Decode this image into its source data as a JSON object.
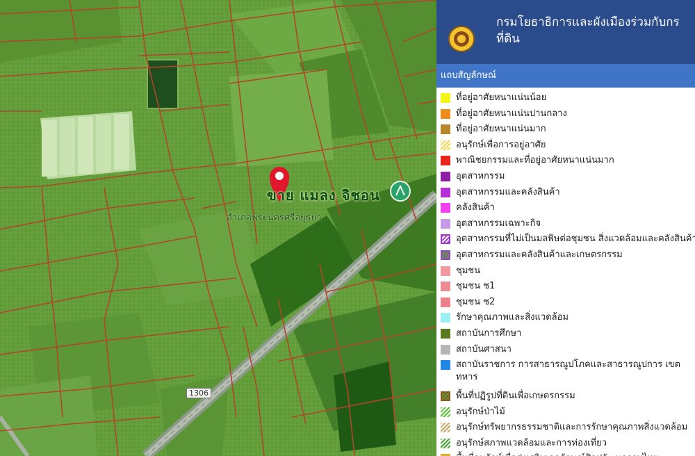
{
  "map": {
    "pin_label": "ขาย แมลง จิชอน",
    "sub_label": "อำเภอพระนครศรีอยุธยา",
    "road_number": "1306"
  },
  "panel": {
    "title": "กรมโยธาธิการและผังเมืองร่วมกับกรมที่ดิน",
    "title_lines": "กรมโยธาธิการและผังเมืองร่วมกับกร\nที่ดิน",
    "legend_tab": "แถบสัญลักษณ์",
    "legend": [
      {
        "label": "ที่อยู่อาศัยหนาแน่นน้อย",
        "color": "#f5f51a",
        "pattern": "solid"
      },
      {
        "label": "ที่อยู่อาศัยหนาแน่นปานกลาง",
        "color": "#f08c1e",
        "pattern": "solid"
      },
      {
        "label": "ที่อยู่อาศัยหนาแน่นมาก",
        "color": "#b8862a",
        "pattern": "solid"
      },
      {
        "label": "อนุรักษ์เพื่อการอยู่อาศัย",
        "color": "#f2d44a",
        "pattern": "hatch"
      },
      {
        "label": "พาณิชยกรรมและที่อยู่อาศัยหนาแน่นมาก",
        "color": "#e8251c",
        "pattern": "solid"
      },
      {
        "label": "อุตสาหกรรม",
        "color": "#8e1fa6",
        "pattern": "solid"
      },
      {
        "label": "อุตสาหกรรมและคลังสินค้า",
        "color": "#b430d6",
        "pattern": "solid"
      },
      {
        "label": "คลังสินค้า",
        "color": "#f23ff2",
        "pattern": "solid"
      },
      {
        "label": "อุตสาหกรรมเฉพาะกิจ",
        "color": "#c79ae8",
        "pattern": "solid"
      },
      {
        "label": "อุตสาหกรรมที่ไม่เป็นมลพิษต่อชุมชน สิ่งแวดล้อมและคลังสินค้า",
        "color": "#a23ad0",
        "pattern": "hatch-box"
      },
      {
        "label": "อุตสาหกรรมและคลังสินค้าและเกษตรกรรม",
        "color": "#8b4fb0",
        "pattern": "hatch-box-green"
      },
      {
        "label": "ชุมชน",
        "color": "#f29aa0",
        "pattern": "solid"
      },
      {
        "label": "ชุมชน ช1",
        "color": "#ee8a92",
        "pattern": "solid"
      },
      {
        "label": "ชุมชน ช2",
        "color": "#e9808a",
        "pattern": "solid"
      },
      {
        "label": "รักษาคุณภาพและสิ่งแวดล้อม",
        "color": "#9af0f0",
        "pattern": "solid"
      },
      {
        "label": "สถาบันการศึกษา",
        "color": "#5a7a1e",
        "pattern": "solid"
      },
      {
        "label": "สถาบันศาสนา",
        "color": "#b5b5b5",
        "pattern": "solid"
      },
      {
        "label": "สถาบันราชการ การสาธารณูปโภคและสาธารณูปการ เขตทหาร",
        "color": "#2188e8",
        "pattern": "solid",
        "tall": true
      },
      {
        "label": "พื้นที่ปฏิรูปที่ดินเพื่อเกษตรกรรม",
        "color": "#8a5a20",
        "pattern": "hatch-box-green"
      },
      {
        "label": "อนุรักษ์ป่าไม้",
        "color": "#5cc23a",
        "pattern": "hatch"
      },
      {
        "label": "อนุรักษ์ทรัพยากรธรรมชาติและการรักษาคุณภาพสิ่งแวดล้อม",
        "color": "#c9a860",
        "pattern": "hatch"
      },
      {
        "label": "อนุรักษ์สภาพแวดล้อมและการท่องเที่ยว",
        "color": "#3ea82a",
        "pattern": "hatch"
      },
      {
        "label": "พื้นที่อนุรักษ์เพื่อส่งเสริมเอกลักษณ์ศิลปวัฒนธรรมไทย",
        "color": "#e0b030",
        "pattern": "solid"
      }
    ]
  },
  "colors": {
    "header_bg": "#2b4c8c",
    "legend_tab_bg": "#3f74c6",
    "parcel_line": "#b0462a",
    "pin": "#e0162b"
  }
}
